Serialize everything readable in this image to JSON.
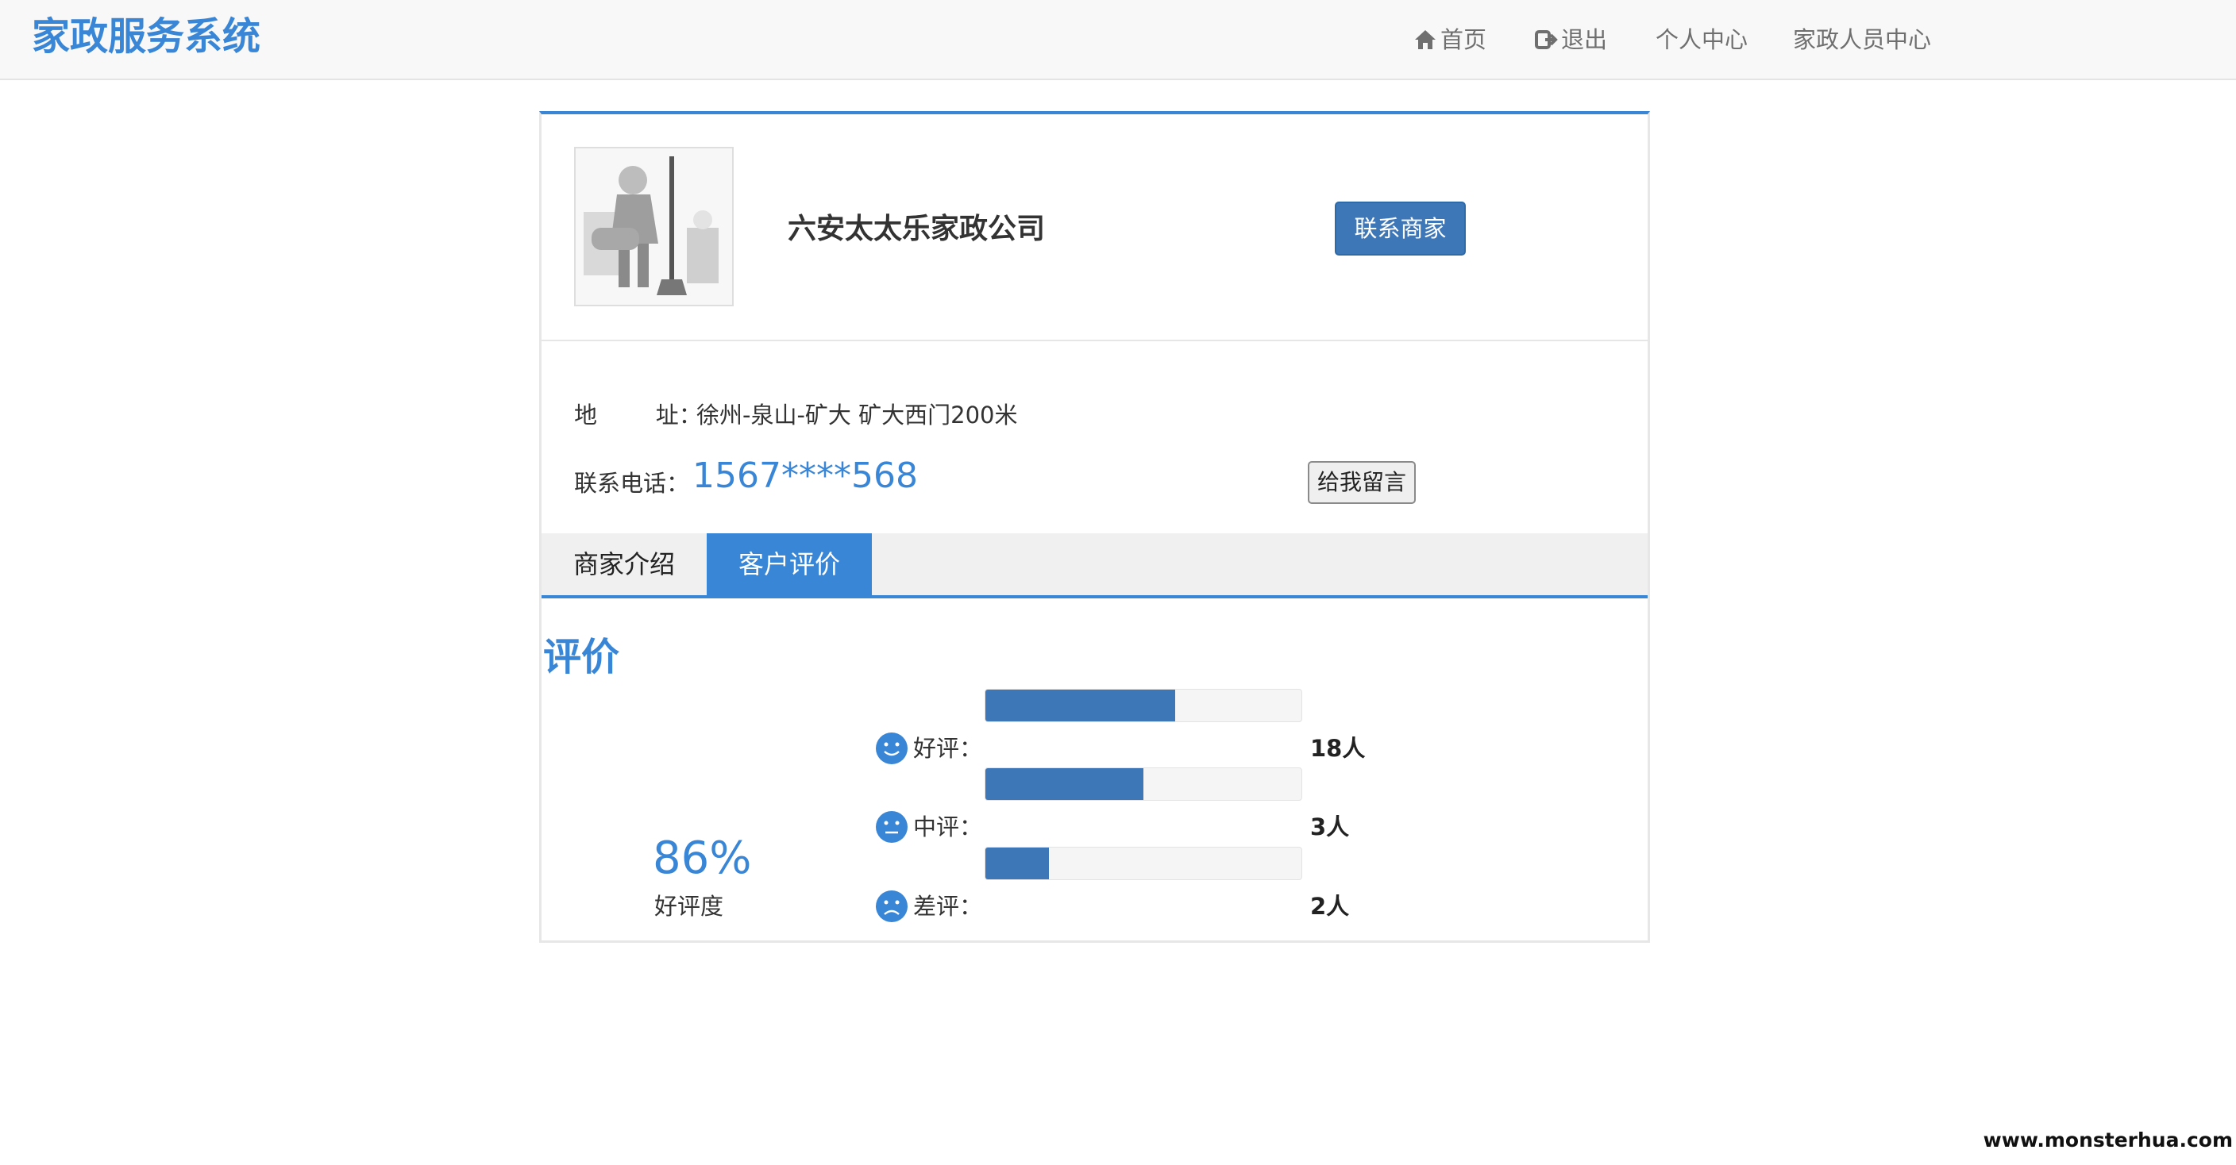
{
  "navbar": {
    "brand": "家政服务系统",
    "items": [
      {
        "label": "首页",
        "icon": "home-icon"
      },
      {
        "label": "退出",
        "icon": "logout-icon"
      },
      {
        "label": "个人中心"
      },
      {
        "label": "家政人员中心"
      }
    ]
  },
  "company": {
    "name": "六安太太乐家政公司",
    "contact_button": "联系商家",
    "address_label": "地        址：",
    "address": "徐州-泉山-矿大 矿大西门200米",
    "phone_label": "联系电话：",
    "phone": "1567****568",
    "message_button": "给我留言"
  },
  "tabs": [
    {
      "label": "商家介绍",
      "active": false
    },
    {
      "label": "客户评价",
      "active": true
    }
  ],
  "reviews": {
    "title": "评价",
    "rate": "86%",
    "rate_label": "好评度",
    "rows": [
      {
        "label": "好评：",
        "count": "18人",
        "fill": 0.6,
        "face": "smile-icon"
      },
      {
        "label": "中评：",
        "count": "3人",
        "fill": 0.5,
        "face": "neutral-face-icon"
      },
      {
        "label": "差评：",
        "count": "2人",
        "fill": 0.2,
        "face": "sad-face-icon"
      }
    ]
  },
  "watermark": "www.monsterhua.com",
  "colors": {
    "accent": "#3a86d6",
    "button": "#3e77b8"
  }
}
